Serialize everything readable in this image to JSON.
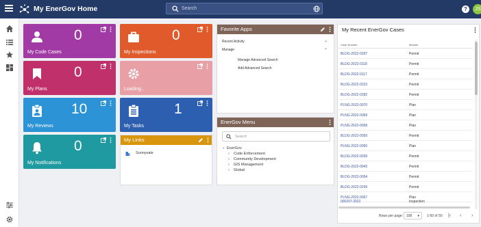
{
  "topbar": {
    "title": "My EnerGov Home",
    "search_placeholder": "Search",
    "avatar_initials": "JS",
    "help_label": "?",
    "bg_color": "#243a66"
  },
  "rail": {
    "items": [
      {
        "icon": "home-icon"
      },
      {
        "icon": "list-icon"
      },
      {
        "icon": "star-icon"
      },
      {
        "icon": "dashboard-icon"
      },
      {
        "icon": "sliders-icon"
      },
      {
        "icon": "gear-icon"
      }
    ]
  },
  "tiles": [
    {
      "label": "My Code Cases",
      "count": "0",
      "color": "#a23aa6",
      "icon": "person-icon"
    },
    {
      "label": "My Inspections",
      "count": "0",
      "color": "#e05a2b",
      "icon": "briefcase-icon"
    },
    {
      "label": "My Plans",
      "count": "0",
      "color": "#c0306a",
      "icon": "bookmark-icon"
    },
    {
      "label": "Loading...",
      "count": "",
      "color": "#e8a0a6",
      "icon": "gear-icon"
    },
    {
      "label": "My Reviews",
      "count": "10",
      "color": "#2b93d6",
      "icon": "clipboard-person-icon"
    },
    {
      "label": "My Tasks",
      "count": "1",
      "color": "#2d5fb0",
      "icon": "clipboard-list-icon"
    },
    {
      "label": "My Notifications",
      "count": "0",
      "color": "#1e9aa0",
      "icon": "bell-icon"
    }
  ],
  "my_links": {
    "title": "My Links",
    "header_color": "#d9950e",
    "items": [
      {
        "label": "Sunnyvale"
      }
    ]
  },
  "favorite_apps": {
    "title": "Favorite Apps",
    "header_color": "#7d6457",
    "sections": [
      {
        "label": "Recent Activity",
        "expanded": false
      },
      {
        "label": "Manage",
        "expanded": true
      }
    ],
    "manage_items": [
      "Manage Advanced Search",
      "Add Advanced Search"
    ]
  },
  "energov_menu": {
    "title": "EnerGov Menu",
    "header_color": "#7d6457",
    "search_placeholder": "Search",
    "root": "EnerGov",
    "children": [
      "Code Enforcement",
      "Community Development",
      "GIS Management",
      "Global"
    ]
  },
  "cases": {
    "title": "My Recent EnerGov Cases",
    "columns": [
      "Case Number",
      "Module"
    ],
    "rows": [
      {
        "case_number": "BLDG-2022-0297",
        "module": "Permit"
      },
      {
        "case_number": "BLDG-2022-0118",
        "module": "Permit"
      },
      {
        "case_number": "BLDG-2022-0117",
        "module": "Permit"
      },
      {
        "case_number": "BLDG-2022-0223",
        "module": "Permit"
      },
      {
        "case_number": "BLDG-2022-0282",
        "module": "Permit"
      },
      {
        "case_number": "PLNG-2022-0070",
        "module": "Plan"
      },
      {
        "case_number": "PLNG-2022-0069",
        "module": "Plan"
      },
      {
        "case_number": "PLNG-2022-0068",
        "module": "Plan"
      },
      {
        "case_number": "BLDG-2022-0059",
        "module": "Permit"
      },
      {
        "case_number": "PLNG-2022-0050",
        "module": "Plan"
      },
      {
        "case_number": "BLDG-2022-0039",
        "module": "Permit"
      },
      {
        "case_number": "BLDG-2022-0043",
        "module": "Permit"
      },
      {
        "case_number": "BLDG-2022-0054",
        "module": "Permit"
      },
      {
        "case_number": "BLDG-2022-0249",
        "module": "Permit"
      },
      {
        "case_number": "PLNG-2022-0067",
        "module": "Plan"
      },
      {
        "case_number": "000207-2022",
        "module": "Inspection"
      }
    ],
    "pager": {
      "rows_per_page_label": "Rows per page:",
      "rows_per_page_value": "100",
      "range": "1-50 of 50"
    }
  }
}
